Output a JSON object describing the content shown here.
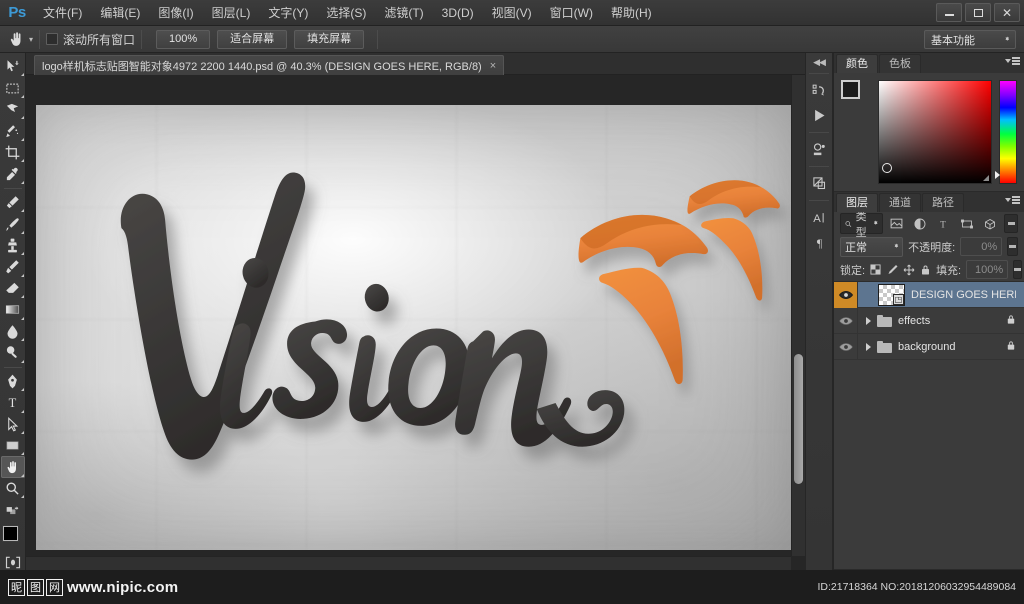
{
  "app": {
    "logo": "Ps",
    "workspace": "基本功能"
  },
  "menubar": {
    "items": [
      {
        "label": "文件(F)",
        "name": "menu-file"
      },
      {
        "label": "编辑(E)",
        "name": "menu-edit"
      },
      {
        "label": "图像(I)",
        "name": "menu-image"
      },
      {
        "label": "图层(L)",
        "name": "menu-layer"
      },
      {
        "label": "文字(Y)",
        "name": "menu-type"
      },
      {
        "label": "选择(S)",
        "name": "menu-select"
      },
      {
        "label": "滤镜(T)",
        "name": "menu-filter"
      },
      {
        "label": "3D(D)",
        "name": "menu-3d"
      },
      {
        "label": "视图(V)",
        "name": "menu-view"
      },
      {
        "label": "窗口(W)",
        "name": "menu-window"
      },
      {
        "label": "帮助(H)",
        "name": "menu-help"
      }
    ]
  },
  "window_controls": {
    "minimize": "minimize-icon",
    "maximize": "restore-icon",
    "close": "close-icon"
  },
  "options_bar": {
    "tool_icon": "hand-tool-icon",
    "scroll_all_windows_label": "滚动所有窗口",
    "scroll_all_windows_checked": false,
    "zoom_100_label": "100%",
    "fit_screen_label": "适合屏幕",
    "fill_screen_label": "填充屏幕"
  },
  "toolbar": {
    "active_tool": "hand-tool",
    "tools": [
      {
        "name": "move-tool",
        "title": "移动工具"
      },
      {
        "name": "marquee-tool",
        "title": "矩形选框工具"
      },
      {
        "name": "lasso-tool",
        "title": "套索工具"
      },
      {
        "name": "quick-selection-tool",
        "title": "快速选择工具"
      },
      {
        "name": "crop-tool",
        "title": "裁剪工具"
      },
      {
        "name": "eyedropper-tool",
        "title": "吸管工具"
      },
      {
        "name": "healing-brush-tool",
        "title": "污点修复画笔工具"
      },
      {
        "name": "brush-tool",
        "title": "画笔工具"
      },
      {
        "name": "clone-stamp-tool",
        "title": "仿制图章工具"
      },
      {
        "name": "history-brush-tool",
        "title": "历史记录画笔工具"
      },
      {
        "name": "eraser-tool",
        "title": "橡皮擦工具"
      },
      {
        "name": "gradient-tool",
        "title": "渐变工具"
      },
      {
        "name": "blur-tool",
        "title": "模糊工具"
      },
      {
        "name": "dodge-tool",
        "title": "减淡工具"
      },
      {
        "name": "pen-tool",
        "title": "钢笔工具"
      },
      {
        "name": "type-tool",
        "title": "横排文字工具"
      },
      {
        "name": "path-selection-tool",
        "title": "路径选择工具"
      },
      {
        "name": "rectangle-tool",
        "title": "矩形工具"
      },
      {
        "name": "hand-tool",
        "title": "抓手工具"
      },
      {
        "name": "zoom-tool",
        "title": "缩放工具"
      }
    ],
    "foreground_color": "#000000",
    "background_color": "#f2d34b",
    "quick_mask_label": "以快速蒙版模式编辑"
  },
  "document_tab": {
    "title": "logo样机标志贴图智能对象4972 2200 1440.psd @ 40.3% (DESIGN GOES HERE, RGB/8)",
    "close": "×",
    "zoom_level": "40.3%"
  },
  "canvas": {
    "artwork_word": "Vision",
    "artwork_description": "3D 立体字墙面标志样机",
    "accent_color": "#e8833a",
    "letter_color": "#3a3a3a",
    "wall_color": "#d9d9d9"
  },
  "panel_rail": {
    "collapse_icon": "collapse-panels-icon",
    "icons": [
      {
        "name": "history-panel-icon",
        "glyph": "↻"
      },
      {
        "name": "timeline-panel-icon",
        "glyph": "▶"
      },
      {
        "name": "properties-panel-icon",
        "glyph": "▣"
      },
      {
        "name": "adjustments-panel-icon",
        "glyph": "◧"
      },
      {
        "name": "character-panel-icon",
        "glyph": "A"
      },
      {
        "name": "paragraph-panel-icon",
        "glyph": "¶"
      }
    ]
  },
  "color_panel": {
    "tabs": [
      {
        "label": "颜色",
        "active": true,
        "name": "tab-color"
      },
      {
        "label": "色板",
        "active": false,
        "name": "tab-swatches"
      }
    ],
    "foreground_color": "#1d1d1d",
    "background_color": "#f2d34b",
    "menu_icon": "panel-menu-icon"
  },
  "layers_panel": {
    "tabs": [
      {
        "label": "图层",
        "active": true,
        "name": "tab-layers"
      },
      {
        "label": "通道",
        "active": false,
        "name": "tab-channels"
      },
      {
        "label": "路径",
        "active": false,
        "name": "tab-paths"
      }
    ],
    "menu_icon": "panel-menu-icon",
    "filter": {
      "icon": "search-icon",
      "value": "类型",
      "pixel_filter": "pixel-layer-filter-icon",
      "adjustment_filter": "adjustment-layer-filter-icon",
      "type_filter": "type-layer-filter-icon",
      "shape_filter": "shape-layer-filter-icon",
      "smartobject_filter": "smart-object-filter-icon",
      "toggle": "filter-toggle-icon"
    },
    "blend_mode": "正常",
    "opacity_label": "不透明度:",
    "opacity_value": "0%",
    "lock_label": "锁定:",
    "lock_icons": [
      {
        "name": "lock-transparent-pixels-icon",
        "glyph": "▩"
      },
      {
        "name": "lock-image-pixels-icon",
        "glyph": "✎"
      },
      {
        "name": "lock-position-icon",
        "glyph": "✥"
      },
      {
        "name": "lock-all-icon",
        "glyph": "🔒"
      }
    ],
    "fill_label": "填充:",
    "fill_value": "100%",
    "layers": [
      {
        "name": "DESIGN GOES HERE",
        "type": "smart-object",
        "visible": true,
        "selected": true,
        "locked": false,
        "expandable": false,
        "thumbnail": "transparent-checkerboard"
      },
      {
        "name": "effects",
        "type": "group",
        "visible": true,
        "selected": false,
        "locked": true,
        "expandable": true,
        "thumbnail": "folder"
      },
      {
        "name": "background",
        "type": "group",
        "visible": true,
        "selected": false,
        "locked": true,
        "expandable": true,
        "thumbnail": "folder"
      }
    ]
  },
  "watermark": {
    "site_cn_chars": [
      "昵",
      "图",
      "网"
    ],
    "url": "www.nipic.com",
    "id_text": "ID:21718364 NO:20181206032954489084"
  }
}
